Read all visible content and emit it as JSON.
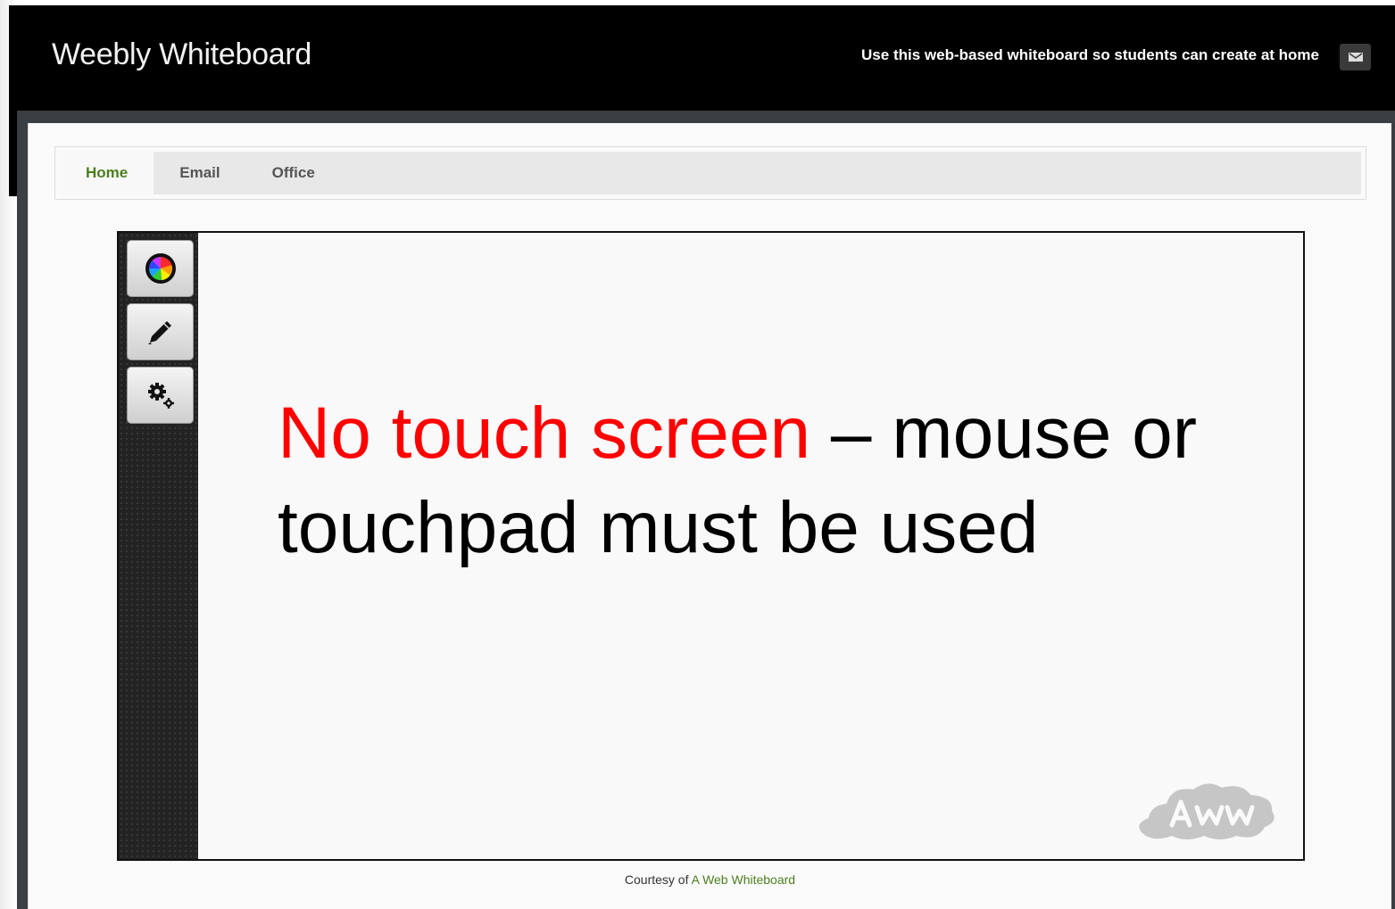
{
  "header": {
    "site_title": "Weebly Whiteboard",
    "tagline": "Use this web-based whiteboard so students can create at home",
    "mail_icon": "mail-icon"
  },
  "nav": {
    "items": [
      {
        "label": "Home",
        "active": true
      },
      {
        "label": "Email",
        "active": false
      },
      {
        "label": "Office",
        "active": false
      }
    ]
  },
  "whiteboard": {
    "tools": [
      {
        "icon": "color-wheel-icon"
      },
      {
        "icon": "pencil-icon"
      },
      {
        "icon": "settings-gears-icon"
      }
    ],
    "message_highlight": "No touch screen",
    "message_rest": " – mouse or touchpad must be used",
    "logo_text": "AWW"
  },
  "footer": {
    "prefix": "Courtesy of",
    "link_text": "A Web Whiteboard"
  },
  "colors": {
    "header_bg": "#000000",
    "nav_active": "#4c7f1e",
    "highlight_red": "#ff0000",
    "toolbar_bg": "#232323"
  }
}
